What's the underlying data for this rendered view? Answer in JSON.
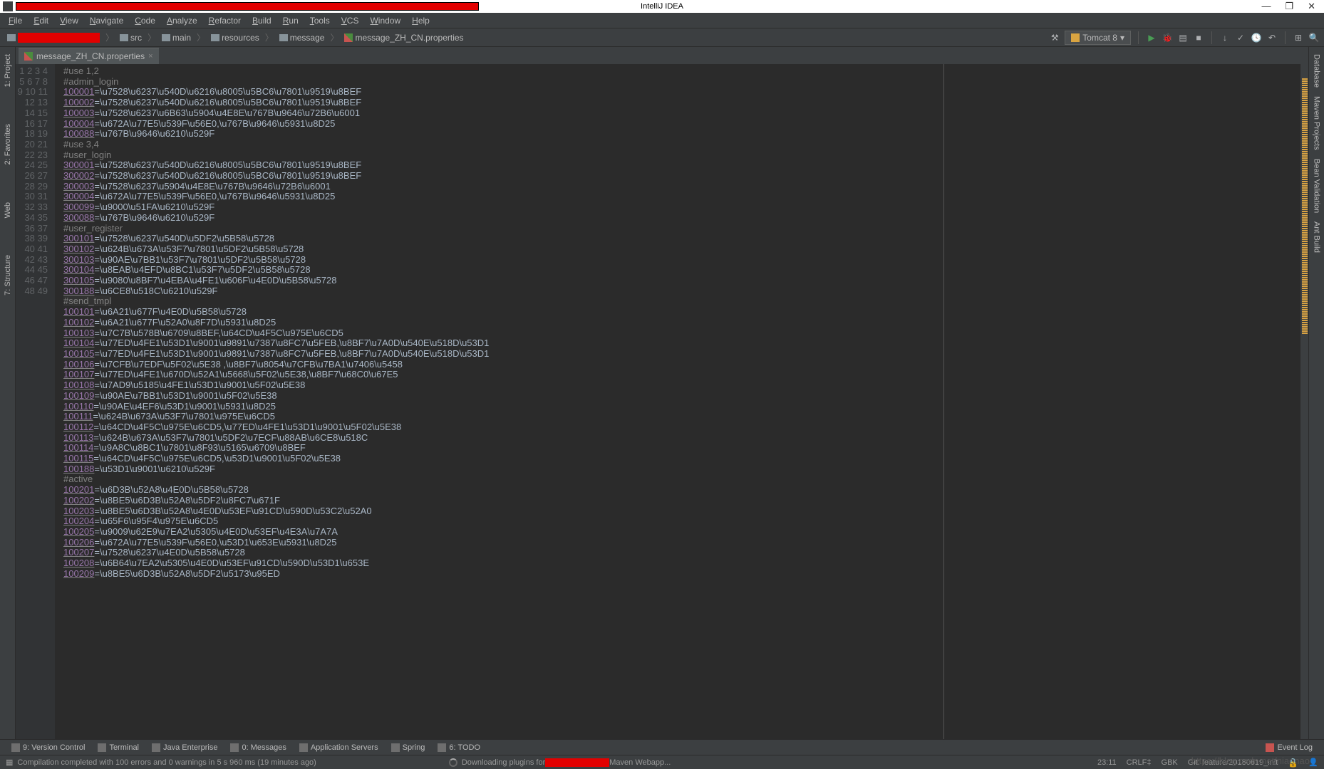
{
  "title": "IntelliJ IDEA",
  "menu": [
    "File",
    "Edit",
    "View",
    "Navigate",
    "Code",
    "Analyze",
    "Refactor",
    "Build",
    "Run",
    "Tools",
    "VCS",
    "Window",
    "Help"
  ],
  "breadcrumb": [
    "",
    "src",
    "main",
    "resources",
    "message",
    "message_ZH_CN.properties"
  ],
  "run_config": "Tomcat 8",
  "tab_name": "message_ZH_CN.properties",
  "code": [
    {
      "n": 1,
      "t": "comment",
      "txt": "#use 1,2"
    },
    {
      "n": 2,
      "t": "comment",
      "txt": "#admin_login"
    },
    {
      "n": 3,
      "k": "100001",
      "v": "\\u7528\\u6237\\u540D\\u6216\\u8005\\u5BC6\\u7801\\u9519\\u8BEF"
    },
    {
      "n": 4,
      "k": "100002",
      "v": "\\u7528\\u6237\\u540D\\u6216\\u8005\\u5BC6\\u7801\\u9519\\u8BEF"
    },
    {
      "n": 5,
      "k": "100003",
      "v": "\\u7528\\u6237\\u6B63\\u5904\\u4E8E\\u767B\\u9646\\u72B6\\u6001"
    },
    {
      "n": 6,
      "k": "100004",
      "v": "\\u672A\\u77E5\\u539F\\u56E0,\\u767B\\u9646\\u5931\\u8D25"
    },
    {
      "n": 7,
      "k": "100088",
      "v": "\\u767B\\u9646\\u6210\\u529F"
    },
    {
      "n": 8,
      "t": "comment",
      "txt": "#use 3,4"
    },
    {
      "n": 9,
      "t": "comment",
      "txt": "#user_login"
    },
    {
      "n": 10,
      "k": "300001",
      "v": "\\u7528\\u6237\\u540D\\u6216\\u8005\\u5BC6\\u7801\\u9519\\u8BEF"
    },
    {
      "n": 11,
      "k": "300002",
      "v": "\\u7528\\u6237\\u540D\\u6216\\u8005\\u5BC6\\u7801\\u9519\\u8BEF"
    },
    {
      "n": 12,
      "k": "300003",
      "v": "\\u7528\\u6237\\u5904\\u4E8E\\u767B\\u9646\\u72B6\\u6001"
    },
    {
      "n": 13,
      "k": "300004",
      "v": "\\u672A\\u77E5\\u539F\\u56E0,\\u767B\\u9646\\u5931\\u8D25"
    },
    {
      "n": 14,
      "k": "300099",
      "v": "\\u9000\\u51FA\\u6210\\u529F"
    },
    {
      "n": 15,
      "k": "300088",
      "v": "\\u767B\\u9646\\u6210\\u529F"
    },
    {
      "n": 16,
      "t": "comment",
      "txt": "#user_register"
    },
    {
      "n": 17,
      "k": "300101",
      "v": "\\u7528\\u6237\\u540D\\u5DF2\\u5B58\\u5728"
    },
    {
      "n": 18,
      "k": "300102",
      "v": "\\u624B\\u673A\\u53F7\\u7801\\u5DF2\\u5B58\\u5728"
    },
    {
      "n": 19,
      "k": "300103",
      "v": "\\u90AE\\u7BB1\\u53F7\\u7801\\u5DF2\\u5B58\\u5728"
    },
    {
      "n": 20,
      "k": "300104",
      "v": "\\u8EAB\\u4EFD\\u8BC1\\u53F7\\u5DF2\\u5B58\\u5728"
    },
    {
      "n": 21,
      "k": "300105",
      "v": "\\u9080\\u8BF7\\u4EBA\\u4FE1\\u606F\\u4E0D\\u5B58\\u5728"
    },
    {
      "n": 22,
      "k": "300188",
      "v": "\\u6CE8\\u518C\\u6210\\u529F"
    },
    {
      "n": 23,
      "t": "comment",
      "txt": "#send_tmpl",
      "hl": true
    },
    {
      "n": 24,
      "k": "100101",
      "v": "\\u6A21\\u677F\\u4E0D\\u5B58\\u5728"
    },
    {
      "n": 25,
      "k": "100102",
      "v": "\\u6A21\\u677F\\u52A0\\u8F7D\\u5931\\u8D25"
    },
    {
      "n": 26,
      "k": "100103",
      "v": "\\u7C7B\\u578B\\u6709\\u8BEF,\\u64CD\\u4F5C\\u975E\\u6CD5"
    },
    {
      "n": 27,
      "k": "100104",
      "v": "\\u77ED\\u4FE1\\u53D1\\u9001\\u9891\\u7387\\u8FC7\\u5FEB,\\u8BF7\\u7A0D\\u540E\\u518D\\u53D1"
    },
    {
      "n": 28,
      "k": "100105",
      "v": "\\u77ED\\u4FE1\\u53D1\\u9001\\u9891\\u7387\\u8FC7\\u5FEB,\\u8BF7\\u7A0D\\u540E\\u518D\\u53D1"
    },
    {
      "n": 29,
      "k": "100106",
      "v": "\\u7CFB\\u7EDF\\u5F02\\u5E38 ,\\u8BF7\\u8054\\u7CFB\\u7BA1\\u7406\\u5458"
    },
    {
      "n": 30,
      "k": "100107",
      "v": "\\u77ED\\u4FE1\\u670D\\u52A1\\u5668\\u5F02\\u5E38,\\u8BF7\\u68C0\\u67E5"
    },
    {
      "n": 31,
      "k": "100108",
      "v": "\\u7AD9\\u5185\\u4FE1\\u53D1\\u9001\\u5F02\\u5E38"
    },
    {
      "n": 32,
      "k": "100109",
      "v": "\\u90AE\\u7BB1\\u53D1\\u9001\\u5F02\\u5E38"
    },
    {
      "n": 33,
      "k": "100110",
      "v": "\\u90AE\\u4EF6\\u53D1\\u9001\\u5931\\u8D25"
    },
    {
      "n": 34,
      "k": "100111",
      "v": "\\u624B\\u673A\\u53F7\\u7801\\u975E\\u6CD5"
    },
    {
      "n": 35,
      "k": "100112",
      "v": "\\u64CD\\u4F5C\\u975E\\u6CD5,\\u77ED\\u4FE1\\u53D1\\u9001\\u5F02\\u5E38"
    },
    {
      "n": 36,
      "k": "100113",
      "v": "\\u624B\\u673A\\u53F7\\u7801\\u5DF2\\u7ECF\\u88AB\\u6CE8\\u518C"
    },
    {
      "n": 37,
      "k": "100114",
      "v": "\\u9A8C\\u8BC1\\u7801\\u8F93\\u5165\\u6709\\u8BEF"
    },
    {
      "n": 38,
      "k": "100115",
      "v": "\\u64CD\\u4F5C\\u975E\\u6CD5,\\u53D1\\u9001\\u5F02\\u5E38"
    },
    {
      "n": 39,
      "k": "100188",
      "v": "\\u53D1\\u9001\\u6210\\u529F"
    },
    {
      "n": 40,
      "t": "comment",
      "txt": "#active"
    },
    {
      "n": 41,
      "k": "100201",
      "v": "\\u6D3B\\u52A8\\u4E0D\\u5B58\\u5728"
    },
    {
      "n": 42,
      "k": "100202",
      "v": "\\u8BE5\\u6D3B\\u52A8\\u5DF2\\u8FC7\\u671F"
    },
    {
      "n": 43,
      "k": "100203",
      "v": "\\u8BE5\\u6D3B\\u52A8\\u4E0D\\u53EF\\u91CD\\u590D\\u53C2\\u52A0"
    },
    {
      "n": 44,
      "k": "100204",
      "v": "\\u65F6\\u95F4\\u975E\\u6CD5"
    },
    {
      "n": 45,
      "k": "100205",
      "v": "\\u9009\\u62E9\\u7EA2\\u5305\\u4E0D\\u53EF\\u4E3A\\u7A7A"
    },
    {
      "n": 46,
      "k": "100206",
      "v": "\\u672A\\u77E5\\u539F\\u56E0,\\u53D1\\u653E\\u5931\\u8D25"
    },
    {
      "n": 47,
      "k": "100207",
      "v": "\\u7528\\u6237\\u4E0D\\u5B58\\u5728"
    },
    {
      "n": 48,
      "k": "100208",
      "v": "\\u6B64\\u7EA2\\u5305\\u4E0D\\u53EF\\u91CD\\u590D\\u53D1\\u653E"
    },
    {
      "n": 49,
      "k": "100209",
      "v": "\\u8BE5\\u6D3B\\u52A8\\u5DF2\\u5173\\u95ED"
    }
  ],
  "bottom_tabs": [
    "9: Version Control",
    "Terminal",
    "Java Enterprise",
    "0: Messages",
    "Application Servers",
    "Spring",
    "6: TODO"
  ],
  "event_log": "Event Log",
  "status_left": "Compilation completed with 100 errors and 0 warnings in 5 s 960 ms (19 minutes ago)",
  "status_mid_a": "Downloading plugins for ",
  "status_mid_b": " Maven Webapp...",
  "status_right": {
    "time": "23:11",
    "sep": "CRLF‡",
    "enc": "GBK",
    "git": "Git: feature/20180619_init",
    "pad": "⬚"
  },
  "right_tabs": [
    "Database",
    "Maven Projects",
    "Bean Validation",
    "Ant Build"
  ],
  "left_tabs": [
    "1: Project",
    "2: Favorites",
    "Web",
    "7: Structure"
  ],
  "watermark": "https://blog.csdn.net/niaonao"
}
